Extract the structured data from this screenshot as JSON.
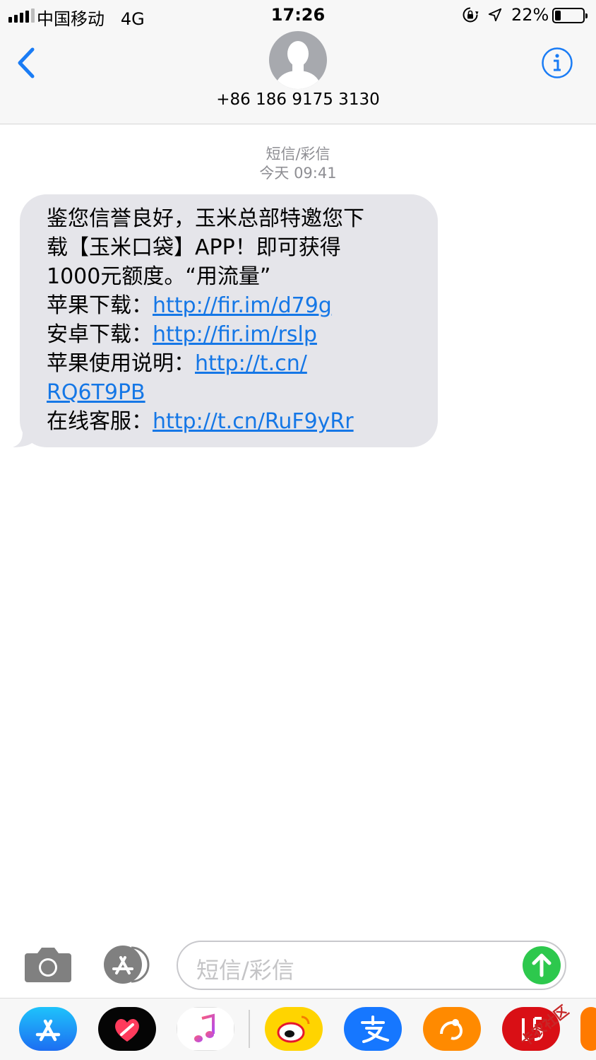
{
  "status_bar": {
    "carrier": "中国移动",
    "network": "4G",
    "time": "17:26",
    "battery_percent": "22%",
    "battery_level": 0.22,
    "icons": [
      "signal-bars-icon",
      "rotation-lock-icon",
      "location-arrow-icon",
      "battery-icon"
    ]
  },
  "header": {
    "contact": "+86 186 9175 3130",
    "icons": [
      "back-chevron-icon",
      "contact-avatar",
      "info-icon"
    ]
  },
  "conversation": {
    "message_type": "短信/彩信",
    "timestamp": "今天 09:41",
    "message": {
      "line1": "鉴您信誉良好，玉米总部特邀您下",
      "line2": "载【玉米口袋】APP！即可获得",
      "line3": "1000元额度。“用流量”",
      "apple_download_label": "苹果下载：",
      "apple_download_link": "http://fir.im/d79g",
      "android_download_label": "安卓下载：",
      "android_download_link": "http://fir.im/rslp",
      "apple_guide_label": "苹果使用说明：",
      "apple_guide_link_part1": "http://t.cn/",
      "apple_guide_link_part2": "RQ6T9PB",
      "support_label": "在线客服：",
      "support_link": "http://t.cn/RuF9yRr"
    }
  },
  "input_bar": {
    "placeholder": "短信/彩信",
    "icons": [
      "camera-icon",
      "app-store-icon",
      "send-arrow-icon"
    ]
  },
  "app_tray": {
    "apps": [
      "app-store-icon",
      "digital-touch-icon",
      "music-icon",
      "weibo-icon",
      "alipay-icon",
      "uc-browser-icon",
      "app-icon"
    ],
    "watermark": "卡农社区"
  },
  "colors": {
    "link": "#1577e6",
    "bubble": "#e5e5ea",
    "accent": "#1a7cf5",
    "send": "#2dc84d",
    "meta_text": "#8e8e93"
  }
}
